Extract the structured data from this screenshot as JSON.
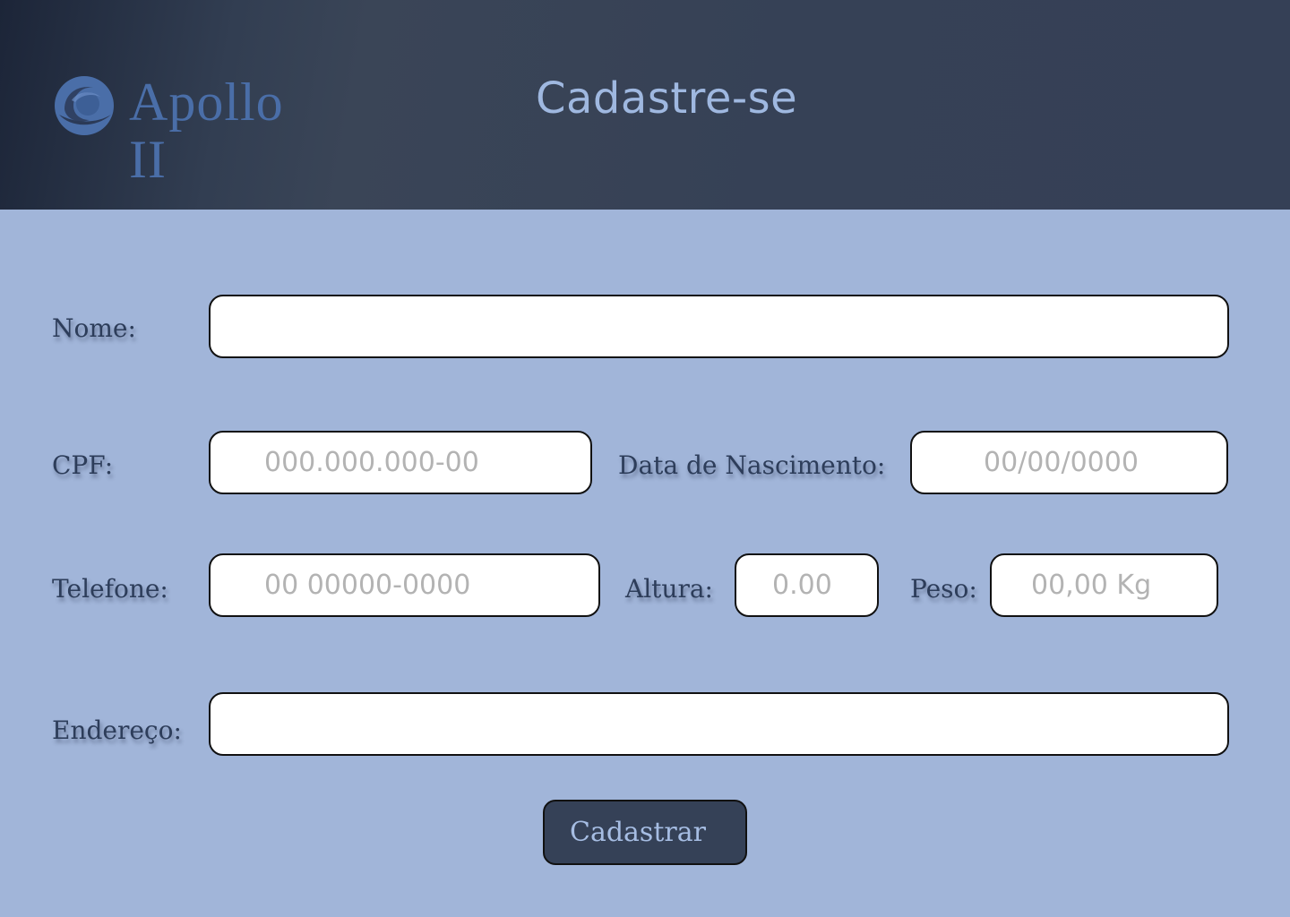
{
  "header": {
    "brand_name": "Apollo II",
    "title": "Cadastre-se"
  },
  "form": {
    "nome": {
      "label": "Nome:",
      "placeholder": ""
    },
    "cpf": {
      "label": "CPF:",
      "placeholder": "000.000.000-00"
    },
    "nascimento": {
      "label": "Data de Nascimento:",
      "placeholder": "00/00/0000"
    },
    "telefone": {
      "label": "Telefone:",
      "placeholder": "00 00000-0000"
    },
    "altura": {
      "label": "Altura:",
      "placeholder": "0.00"
    },
    "peso": {
      "label": "Peso:",
      "placeholder": "00,00 Kg"
    },
    "endereco": {
      "label": "Endereço:",
      "placeholder": ""
    },
    "submit_label": "Cadastrar"
  },
  "colors": {
    "background": "#a1b5d9",
    "header": "#354056",
    "brand": "#4a6ea8",
    "button": "#354157"
  },
  "icons": {
    "logo": "wave-circle-logo-icon"
  }
}
